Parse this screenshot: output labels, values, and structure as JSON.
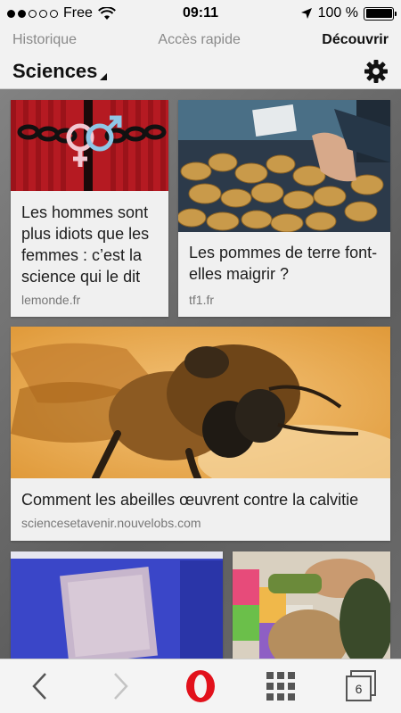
{
  "status": {
    "carrier": "Free",
    "time": "09:11",
    "battery_text": "100 %",
    "signal_filled": 2,
    "signal_total": 5
  },
  "nav": {
    "tabs": [
      {
        "label": "Historique",
        "active": false
      },
      {
        "label": "Accès rapide",
        "active": false
      },
      {
        "label": "Découvrir",
        "active": true
      }
    ]
  },
  "header": {
    "category": "Sciences",
    "settings_icon": "gear-icon"
  },
  "articles": [
    {
      "title": "Les hommes sont plus idiots que les femmes : c’est la science qui le dit",
      "source": "lemonde.fr",
      "image": "gender-symbols-chain"
    },
    {
      "title": "Les pommes de terre font-elles maigrir ?",
      "source": "tf1.fr",
      "image": "potatoes-market"
    },
    {
      "title": "Comment les abeilles œuvrent contre la calvitie",
      "source": "sciencesetavenir.nouvelobs.com",
      "image": "bee-closeup"
    },
    {
      "title": "",
      "source": "",
      "image": "glass-slide-blue"
    },
    {
      "title": "",
      "source": "",
      "image": "hair-treatment"
    }
  ],
  "toolbar": {
    "back_icon": "chevron-left-icon",
    "forward_icon": "chevron-right-icon",
    "opera_icon": "opera-logo-icon",
    "speed_dial_icon": "grid-icon",
    "tabs_count": "6"
  },
  "colors": {
    "opera_red": "#e2111b",
    "accent_text": "#111111",
    "muted_text": "#8a8a8a"
  }
}
